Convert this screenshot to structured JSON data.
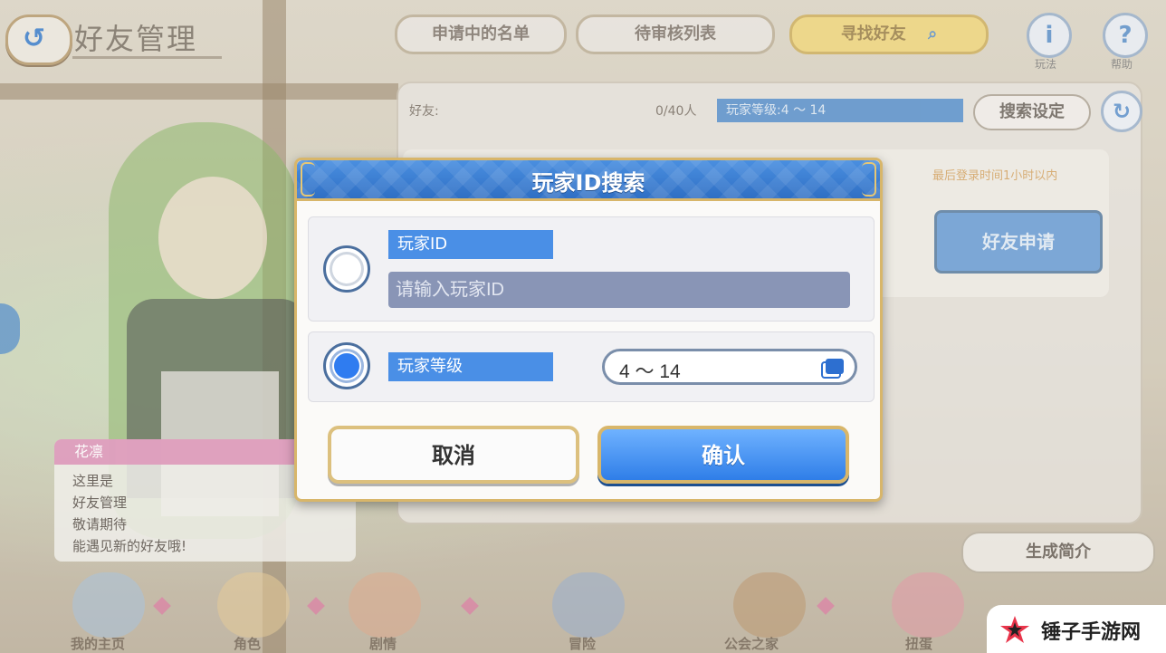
{
  "header": {
    "back_icon": "back-arrow-icon",
    "title": "好友管理",
    "tabs": [
      {
        "label": "申请中的名单",
        "active": false
      },
      {
        "label": "待审核列表",
        "active": false
      },
      {
        "label": "寻找好友",
        "active": true
      }
    ],
    "help_buttons": [
      {
        "icon": "info-icon",
        "glyph": "i",
        "label": "玩法"
      },
      {
        "icon": "question-icon",
        "glyph": "?",
        "label": "帮助"
      }
    ]
  },
  "friends_panel": {
    "friends_label": "好友:",
    "count": "0/40人",
    "level_filter": "玩家等级:4 ～ 14",
    "search_settings_label": "搜索设定",
    "refresh_icon": "refresh-icon",
    "refresh_glyph": "↻",
    "last_login": "最后登录时间1小时以内",
    "friend_request_label": "好友申请"
  },
  "character": {
    "name": "花凛",
    "speech_lines": [
      "这里是",
      "好友管理",
      "敬请期待",
      "能遇见新的好友哦!"
    ]
  },
  "profile_button": "生成简介",
  "bottom_nav": [
    "我的主页",
    "角色",
    "剧情",
    "冒险",
    "公会之家",
    "扭蛋"
  ],
  "dialog": {
    "title": "玩家ID搜索",
    "player_id_label": "玩家ID",
    "player_id_placeholder": "请输入玩家ID",
    "player_id_value": "",
    "player_id_selected": false,
    "player_level_label": "玩家等级",
    "player_level_value": "4 ～ 14",
    "player_level_selected": true,
    "cancel_label": "取消",
    "confirm_label": "确认"
  },
  "watermark": "锤子手游网",
  "colors": {
    "accent": "#2f7ee8",
    "gold": "#d8b66a",
    "active_tab": "#f0d36a"
  }
}
